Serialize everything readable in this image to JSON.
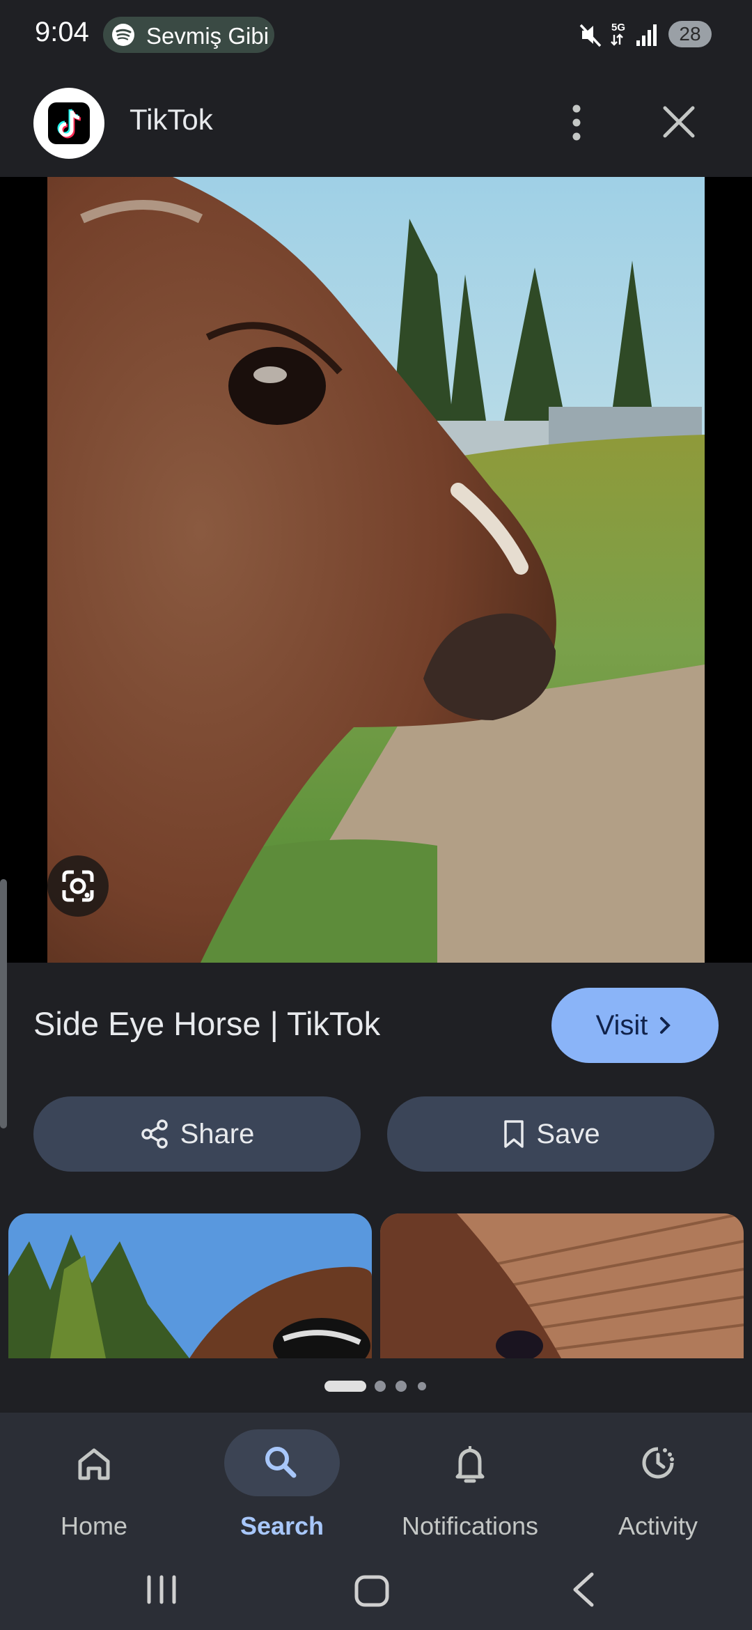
{
  "status_bar": {
    "time": "9:04",
    "now_playing": "Sevmiş Gibi",
    "battery": "28"
  },
  "header": {
    "app_name": "TikTok",
    "logo_icon": "tiktok-logo-icon",
    "more_icon": "more-vertical-icon",
    "close_icon": "close-icon"
  },
  "result": {
    "caption": "Side Eye Horse | TikTok",
    "visit_label": "Visit",
    "share_label": "Share",
    "save_label": "Save"
  },
  "pager": {
    "count": 4,
    "active": 0
  },
  "bottom_nav": {
    "items": [
      {
        "label": "Home",
        "icon": "home-icon"
      },
      {
        "label": "Search",
        "icon": "search-icon"
      },
      {
        "label": "Notifications",
        "icon": "bell-icon"
      },
      {
        "label": "Activity",
        "icon": "activity-icon"
      }
    ],
    "active_index": 1
  },
  "colors": {
    "background": "#1f2024",
    "accent": "#8ab4f8",
    "button_bg": "#3b4558",
    "nav_bg": "#2b2e36"
  }
}
